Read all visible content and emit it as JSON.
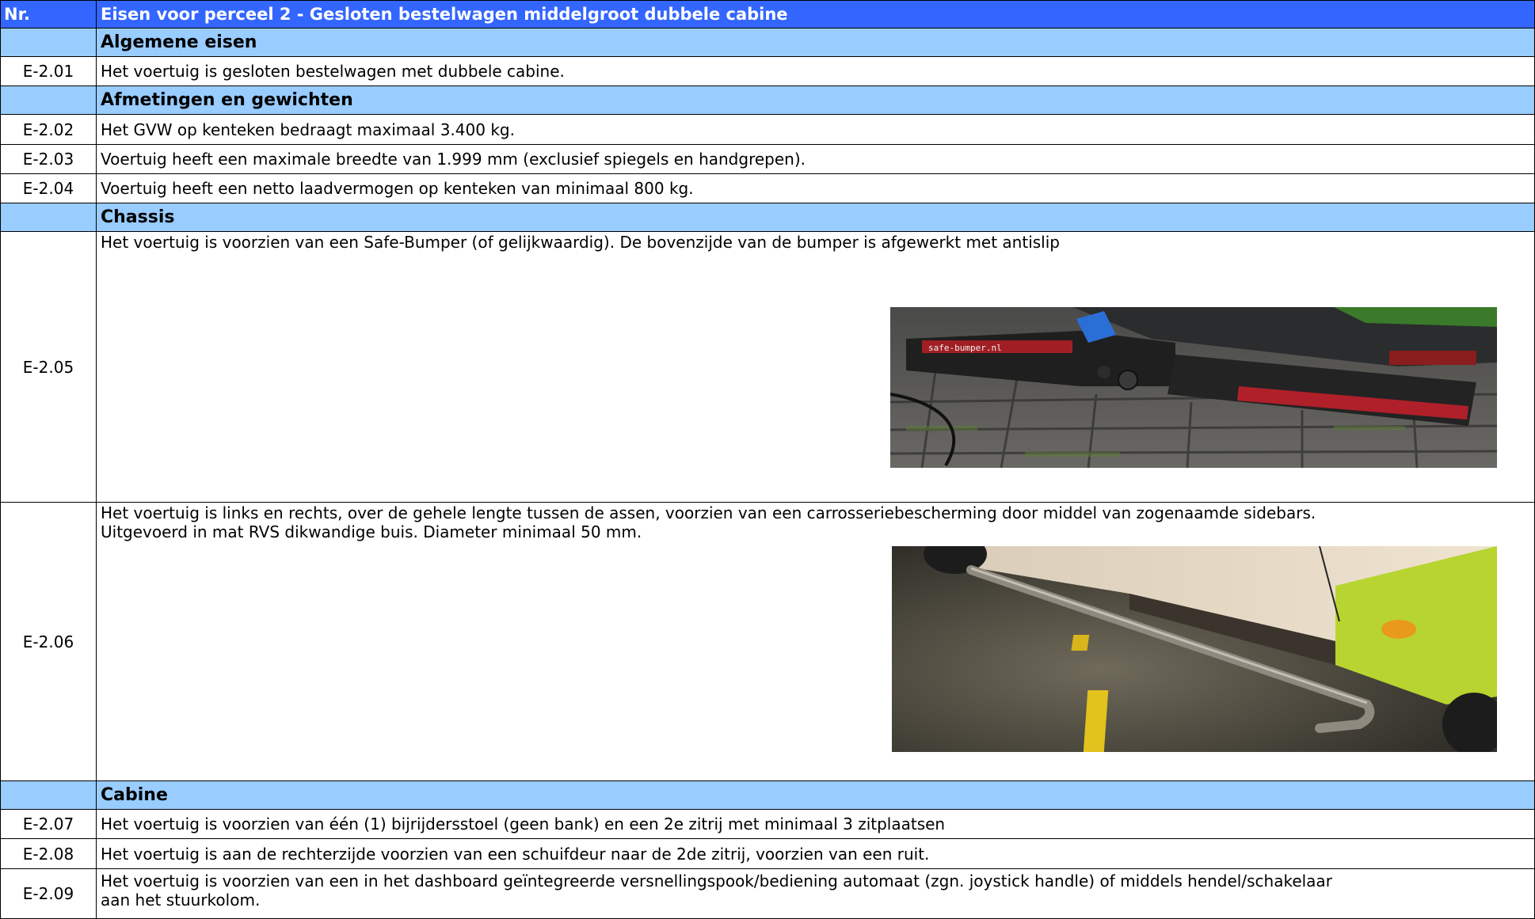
{
  "table": {
    "header": {
      "nr_label": "Nr.",
      "title": "Eisen voor perceel 2 - Gesloten bestelwagen middelgroot dubbele cabine"
    },
    "sections": {
      "algemeen": "Algemene eisen",
      "afmetingen": "Afmetingen en gewichten",
      "chassis": "Chassis",
      "cabine": "Cabine"
    },
    "rows": {
      "e201": {
        "nr": "E-2.01",
        "text": "Het voertuig is gesloten bestelwagen met dubbele cabine."
      },
      "e202": {
        "nr": "E-2.02",
        "text": "Het GVW op kenteken bedraagt maximaal 3.400 kg."
      },
      "e203": {
        "nr": "E-2.03",
        "text": "Voertuig heeft een maximale breedte van 1.999 mm (exclusief spiegels en handgrepen)."
      },
      "e204": {
        "nr": "E-2.04",
        "text": "Voertuig heeft een netto laadvermogen op kenteken van minimaal 800 kg."
      },
      "e205": {
        "nr": "E-2.05",
        "text": "Het voertuig is voorzien van een Safe-Bumper (of gelijkwaardig). De bovenzijde van de bumper is afgewerkt met antislip"
      },
      "e206": {
        "nr": "E-2.06",
        "text_line1": "Het voertuig is links en rechts, over de gehele lengte tussen de assen, voorzien van een carrosseriebescherming door middel van zogenaamde sidebars.",
        "text_line2": "Uitgevoerd in mat RVS dikwandige buis. Diameter minimaal 50 mm."
      },
      "e207": {
        "nr": "E-2.07",
        "text": "Het voertuig is voorzien van één (1) bijrijdersstoel (geen bank) en een 2e zitrij met minimaal 3 zitplaatsen"
      },
      "e208": {
        "nr": "E-2.08",
        "text": "Het voertuig is aan de rechterzijde voorzien van een schuifdeur naar de 2de zitrij, voorzien van een ruit."
      },
      "e209": {
        "nr": "E-2.09",
        "text_line1": "Het voertuig is voorzien van een in het dashboard geïntegreerde versnellingspook/bediening automaat (zgn. joystick handle) of middels hendel/schakelaar",
        "text_line2": "aan het stuurkolom."
      }
    }
  },
  "photos": {
    "bumper_sticker": "safe-bumper.nl"
  }
}
